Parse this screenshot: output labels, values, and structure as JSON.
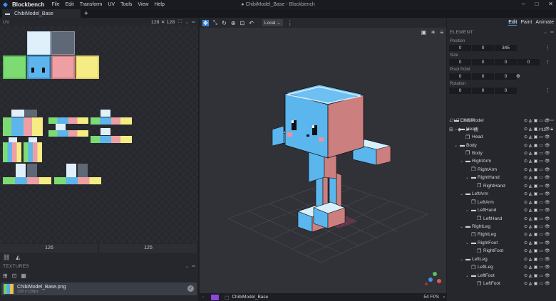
{
  "app": {
    "name": "Blockbench",
    "window_title": "● ChibiModel_Base - Blockbench"
  },
  "menu": [
    "File",
    "Edit",
    "Transform",
    "UV",
    "Tools",
    "View",
    "Help"
  ],
  "tab": {
    "label": "ChibiModel_Base",
    "new_tab": "+"
  },
  "uv_panel": {
    "title": "UV",
    "size": "128 ✕ 128",
    "foot": [
      "126",
      "125"
    ]
  },
  "textures": {
    "title": "TEXTURES",
    "item_name": "ChibiModel_Base.png",
    "item_dims": "128 x 128px"
  },
  "viewport": {
    "space": "Local",
    "camera_label": "ChibiModel_Base",
    "fps": "54 FPS"
  },
  "modes": [
    "Edit",
    "Paint",
    "Animate"
  ],
  "element": {
    "title": "ELEMENT",
    "position": {
      "label": "Position",
      "values": [
        "0",
        "0",
        "345"
      ]
    },
    "size": {
      "label": "Size",
      "values": [
        "0",
        "0",
        "0",
        "0"
      ]
    },
    "pivot": {
      "label": "Pivot Point",
      "values": [
        "0",
        "0",
        "0"
      ]
    },
    "rotation": {
      "label": "Rotation",
      "values": [
        "0",
        "0",
        "0"
      ]
    }
  },
  "outliner": {
    "title": "OUTLINER",
    "count": "1 / 11",
    "items": [
      {
        "label": "ChibiModel",
        "depth": 0,
        "type": "group"
      },
      {
        "label": "Head",
        "depth": 1,
        "type": "group"
      },
      {
        "label": "Head",
        "depth": 2,
        "type": "cube"
      },
      {
        "label": "Body",
        "depth": 1,
        "type": "group"
      },
      {
        "label": "Body",
        "depth": 2,
        "type": "cube"
      },
      {
        "label": "RightArm",
        "depth": 2,
        "type": "group"
      },
      {
        "label": "RightArm",
        "depth": 3,
        "type": "cube"
      },
      {
        "label": "RightHand",
        "depth": 3,
        "type": "group"
      },
      {
        "label": "RightHand",
        "depth": 4,
        "type": "cube"
      },
      {
        "label": "LeftArm",
        "depth": 2,
        "type": "group"
      },
      {
        "label": "LeftArm",
        "depth": 3,
        "type": "cube"
      },
      {
        "label": "LeftHand",
        "depth": 3,
        "type": "group"
      },
      {
        "label": "LeftHand",
        "depth": 4,
        "type": "cube"
      },
      {
        "label": "RightLeg",
        "depth": 2,
        "type": "group"
      },
      {
        "label": "RightLeg",
        "depth": 3,
        "type": "cube"
      },
      {
        "label": "RightFoot",
        "depth": 3,
        "type": "group"
      },
      {
        "label": "RightFoot",
        "depth": 4,
        "type": "cube"
      },
      {
        "label": "LeftLeg",
        "depth": 2,
        "type": "group"
      },
      {
        "label": "LeftLeg",
        "depth": 3,
        "type": "cube"
      },
      {
        "label": "LeftFoot",
        "depth": 3,
        "type": "group"
      },
      {
        "label": "LeftFoot",
        "depth": 4,
        "type": "cube"
      }
    ]
  },
  "colors": {
    "accent": "#3e90ff",
    "panel": "#25272d",
    "viewport": "#303238",
    "camera_badge": "#8b47d9"
  }
}
